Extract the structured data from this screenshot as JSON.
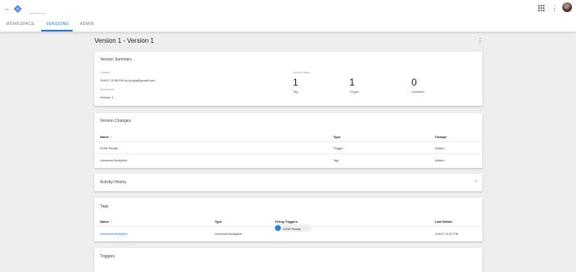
{
  "header": {
    "back_icon": "arrow-back-icon",
    "logo_icon": "tag-manager-logo-icon",
    "apps_icon": "apps-grid-icon",
    "more_icon": "more-vert-icon"
  },
  "tabs": [
    {
      "label": "WORKSPACE"
    },
    {
      "label": "VERSIONS",
      "active": true
    },
    {
      "label": "ADMIN"
    }
  ],
  "accent_color": "#1a73e8",
  "page": {
    "title": "Version 1 - Version 1"
  },
  "summary": {
    "title": "Version Summary",
    "created_label": "Created",
    "created_value": "11/6/17 6:56 PM by ipupla@gmail.com",
    "description_label": "Description",
    "description_value": "Version 1",
    "items_label": "Version Items",
    "counts": [
      {
        "value": "1",
        "label": "Tag"
      },
      {
        "value": "1",
        "label": "Trigger"
      },
      {
        "value": "0",
        "label": "Variables"
      }
    ]
  },
  "changes": {
    "title": "Version Changes",
    "headers": {
      "name": "Name ↑",
      "type": "Type",
      "change": "Change"
    },
    "rows": [
      {
        "name": "DOM Ready",
        "type": "Trigger",
        "change": "Added"
      },
      {
        "name": "Universal Analytics",
        "type": "Tag",
        "change": "Added"
      }
    ]
  },
  "activity": {
    "title": "Activity History"
  },
  "tags": {
    "title": "Tags",
    "headers": {
      "name": "Name ↑",
      "type": "Type",
      "firing": "Firing Triggers",
      "edited": "Last Edited"
    },
    "rows": [
      {
        "name": "Universal Analytics",
        "type": "Universal Analytics",
        "trigger": "DOM Ready",
        "edited": "11/6/17 6:51 PM"
      }
    ]
  },
  "triggers": {
    "title": "Triggers"
  }
}
